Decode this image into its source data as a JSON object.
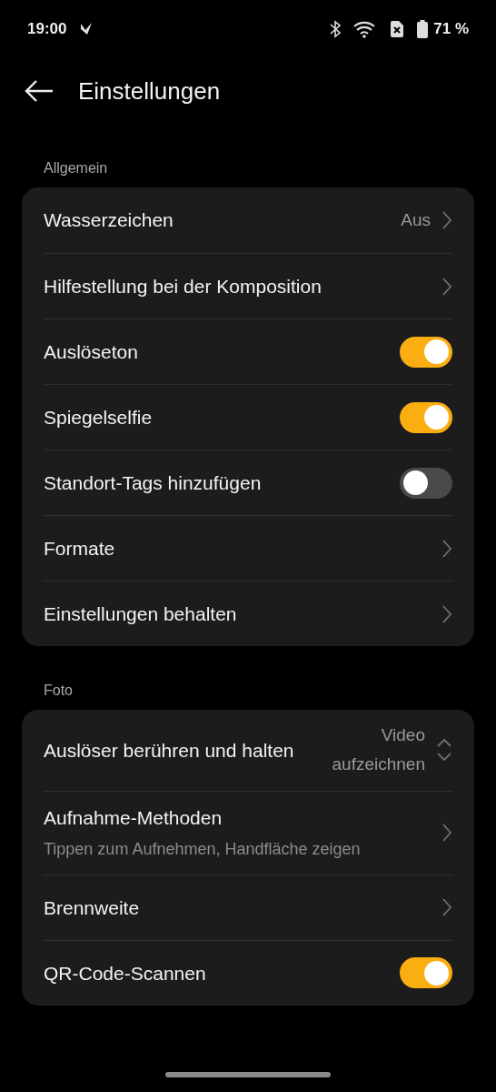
{
  "status_bar": {
    "time": "19:00",
    "battery": "71 %"
  },
  "header": {
    "title": "Einstellungen"
  },
  "sections": [
    {
      "title": "Allgemein",
      "rows": [
        {
          "kind": "nav",
          "label": "Wasserzeichen",
          "value": "Aus"
        },
        {
          "kind": "nav",
          "label": "Hilfestellung bei der Komposition"
        },
        {
          "kind": "toggle",
          "label": "Auslöseton",
          "on": true
        },
        {
          "kind": "toggle",
          "label": "Spiegelselfie",
          "on": true
        },
        {
          "kind": "toggle",
          "label": "Standort-Tags hinzufügen",
          "on": false
        },
        {
          "kind": "nav",
          "label": "Formate"
        },
        {
          "kind": "nav",
          "label": "Einstellungen behalten"
        }
      ]
    },
    {
      "title": "Foto",
      "rows": [
        {
          "kind": "select",
          "label": "Auslöser berühren und halten",
          "value": "Video aufzeichnen"
        },
        {
          "kind": "nav",
          "label": "Aufnahme-Methoden",
          "subtitle": "Tippen zum Aufnehmen, Handfläche zeigen"
        },
        {
          "kind": "nav",
          "label": "Brennweite"
        },
        {
          "kind": "toggle",
          "label": "QR-Code-Scannen",
          "on": true
        }
      ]
    }
  ]
}
